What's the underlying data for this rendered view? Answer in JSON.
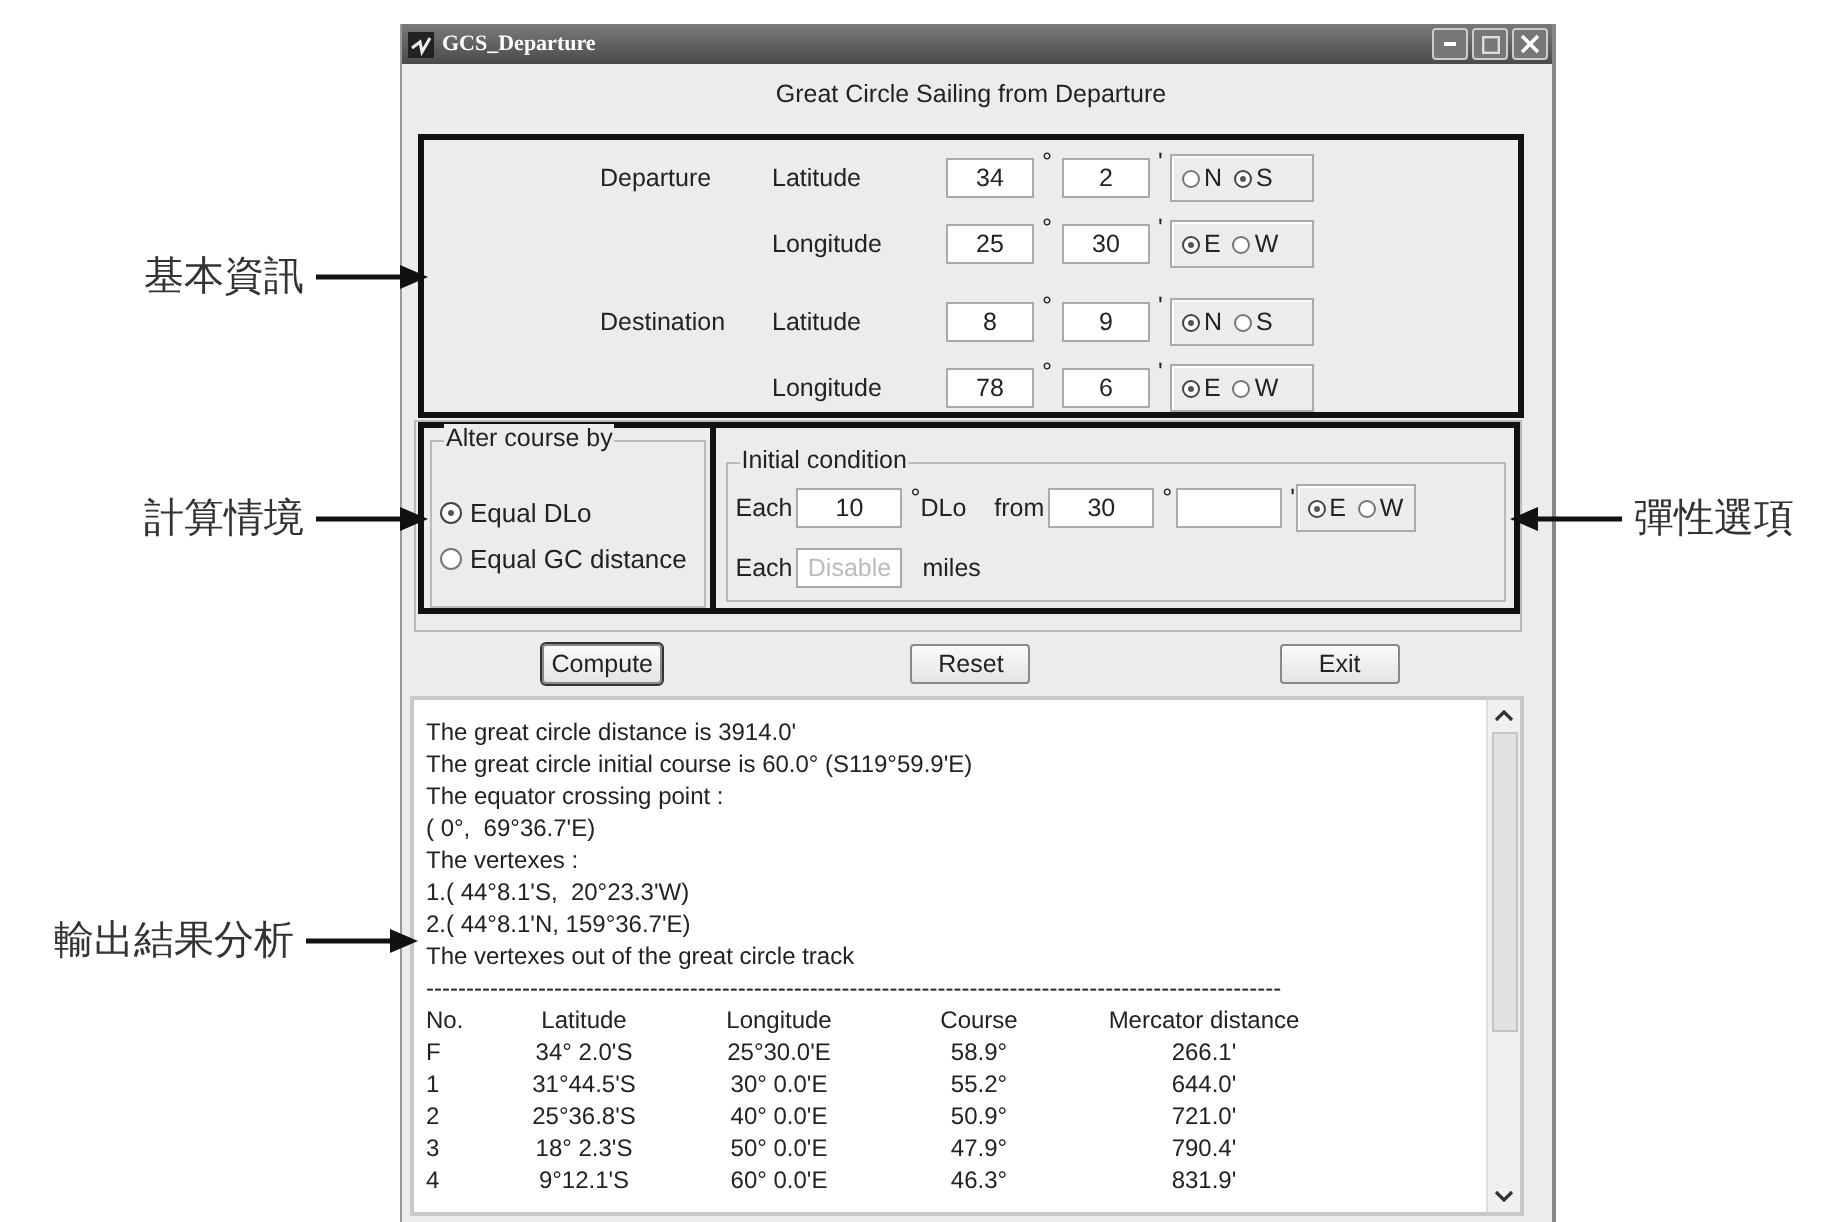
{
  "window": {
    "title": "GCS_Departure"
  },
  "heading": "Great Circle Sailing from Departure",
  "basic_info": {
    "annotation": "基本資訊",
    "locations": [
      {
        "name": "Departure",
        "rows": [
          {
            "label": "Latitude",
            "degrees": "34",
            "degree_sign": "°",
            "minutes": "2",
            "minute_sign": "'",
            "options": [
              {
                "label": "N",
                "selected": false
              },
              {
                "label": "S",
                "selected": true
              }
            ]
          },
          {
            "label": "Longitude",
            "degrees": "25",
            "degree_sign": "°",
            "minutes": "30",
            "minute_sign": "'",
            "options": [
              {
                "label": "E",
                "selected": true
              },
              {
                "label": "W",
                "selected": false
              }
            ]
          }
        ]
      },
      {
        "name": "Destination",
        "rows": [
          {
            "label": "Latitude",
            "degrees": "8",
            "degree_sign": "°",
            "minutes": "9",
            "minute_sign": "'",
            "options": [
              {
                "label": "N",
                "selected": true
              },
              {
                "label": "S",
                "selected": false
              }
            ]
          },
          {
            "label": "Longitude",
            "degrees": "78",
            "degree_sign": "°",
            "minutes": "6",
            "minute_sign": "'",
            "options": [
              {
                "label": "E",
                "selected": true
              },
              {
                "label": "W",
                "selected": false
              }
            ]
          }
        ]
      }
    ]
  },
  "alter_course": {
    "title": "Alter course by",
    "annotation": "計算情境",
    "options": [
      {
        "label": "Equal DLo",
        "selected": true
      },
      {
        "label": "Equal GC distance",
        "selected": false
      }
    ]
  },
  "initial_condition": {
    "title": "Initial condition",
    "annotation": "彈性選項",
    "dlo_row": {
      "each_label": "Each",
      "value": "10",
      "degree_sign": "°",
      "unit": "DLo",
      "from_label": "from",
      "from_degrees": "30",
      "from_degree_sign": "°",
      "minute_sign": "'",
      "options": [
        {
          "label": "E",
          "selected": true
        },
        {
          "label": "W",
          "selected": false
        }
      ]
    },
    "distance_row": {
      "each_label": "Each",
      "value": "Disable",
      "disabled": true,
      "unit": "miles"
    }
  },
  "buttons": [
    "Compute",
    "Reset",
    "Exit"
  ],
  "output": {
    "annotation": "輸出結果分析",
    "lines": [
      "The great circle distance is 3914.0'",
      "The great circle initial course is 60.0° (S119°59.9'E)",
      "The equator crossing point :",
      "( 0°,  69°36.7'E)",
      "The vertexes :",
      "1.( 44°8.1'S,  20°23.3'W)",
      "2.( 44°8.1'N, 159°36.7'E)",
      "The vertexes out of the great circle track"
    ],
    "divider": "-----------------------------------------------------------------------------------------------------------",
    "columns": [
      "No.",
      "Latitude",
      "Longitude",
      "Course",
      "Mercator distance"
    ],
    "rows": [
      [
        "F",
        "34° 2.0'S",
        "25°30.0'E",
        "58.9°",
        "266.1'"
      ],
      [
        "1",
        "31°44.5'S",
        "30° 0.0'E",
        "55.2°",
        "644.0'"
      ],
      [
        "2",
        "25°36.8'S",
        "40° 0.0'E",
        "50.9°",
        "721.0'"
      ],
      [
        "3",
        "18° 2.3'S",
        "50° 0.0'E",
        "47.9°",
        "790.4'"
      ],
      [
        "4",
        "9°12.1'S",
        "60° 0.0'E",
        "46.3°",
        "831.9'"
      ]
    ]
  }
}
